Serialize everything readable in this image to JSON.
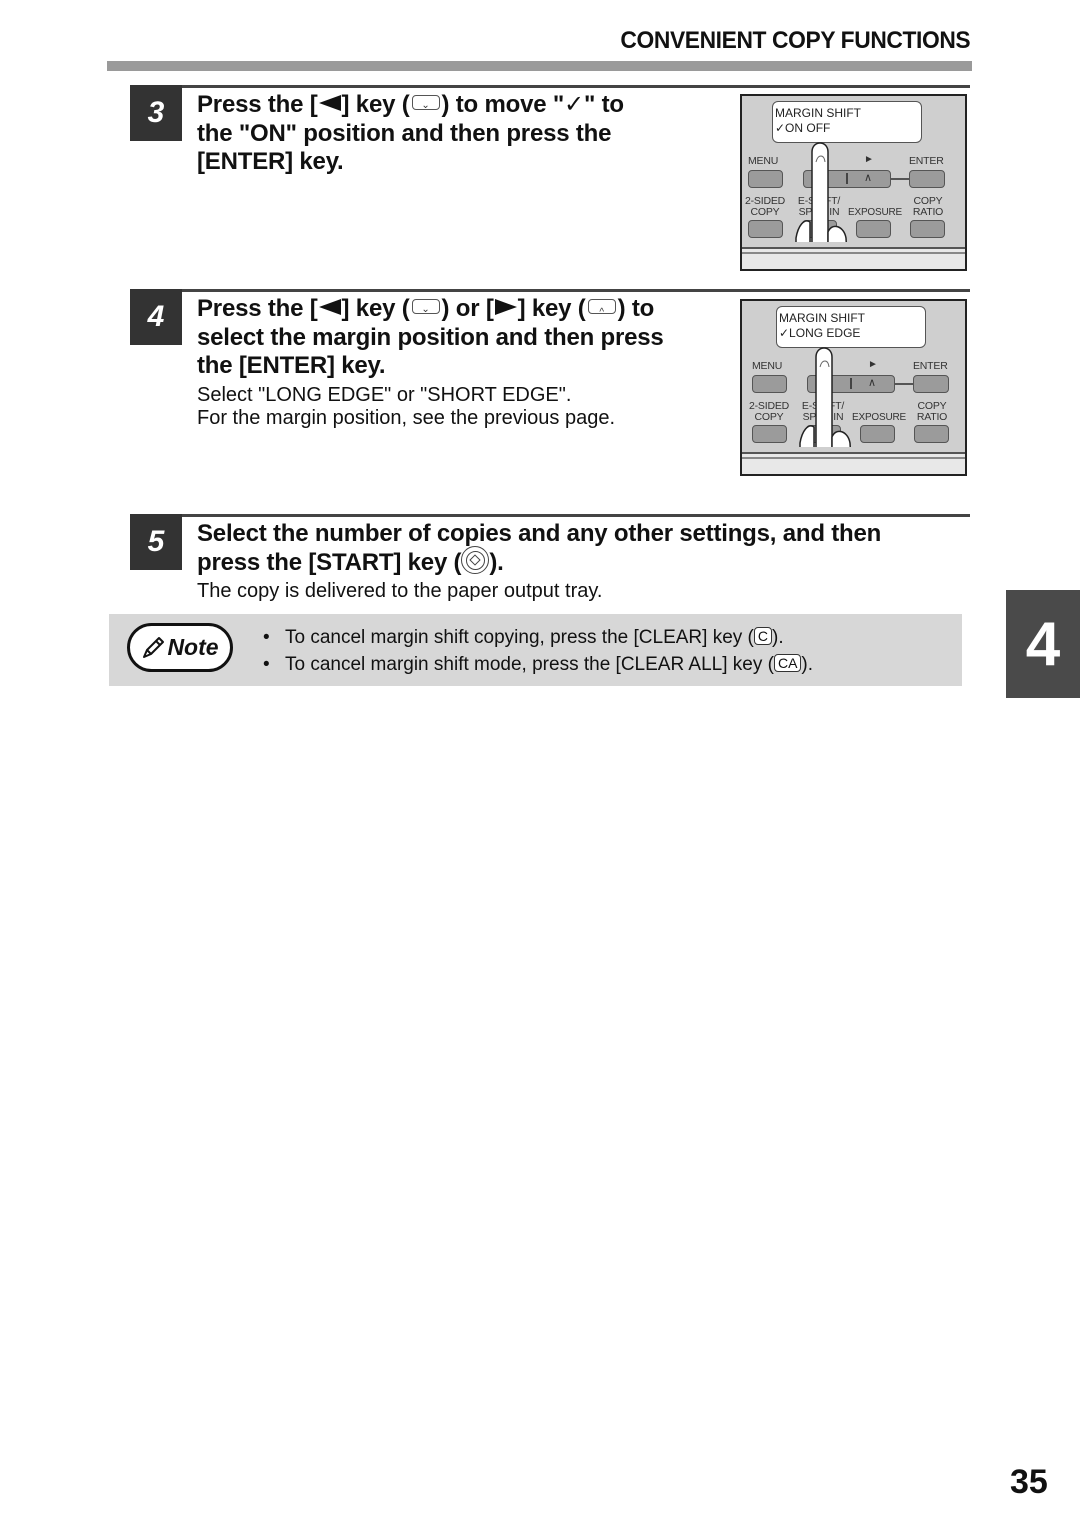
{
  "header": {
    "section_title": "CONVENIENT COPY FUNCTIONS"
  },
  "steps": [
    {
      "number": "3",
      "heading_parts": {
        "a": "Press the [",
        "b": "] key (",
        "c": ") to move \"",
        "d": "\" to",
        "line2": "the \"ON\" position and then press the",
        "line3": "[ENTER] key."
      },
      "check_glyph": "✓",
      "key_glyph_down": "⌄",
      "panel": {
        "lcd_line1": "MARGIN SHIFT",
        "lcd_line2": "✓ON    OFF",
        "labels": {
          "menu": "MENU",
          "left_arrow": "◄",
          "right_arrow": "►",
          "enter": "ENTER",
          "two_sided_1": "2-SIDED",
          "two_sided_2": "COPY",
          "eshift_1": "E-SHIFT/",
          "eshift_2": "SPLIT IN",
          "exposure": "EXPOSURE",
          "copy_ratio_1": "COPY",
          "copy_ratio_2": "RATIO",
          "down_key": "∨",
          "up_key": "∧"
        }
      }
    },
    {
      "number": "4",
      "heading_parts": {
        "a": "Press the [",
        "b": "] key (",
        "c": ") or [",
        "d": "] key (",
        "e": ") to",
        "line2": "select the margin position and then press",
        "line3": "the [ENTER] key."
      },
      "key_glyph_down": "⌄",
      "key_glyph_up": "^",
      "sub_lines": [
        "Select \"LONG EDGE\" or \"SHORT EDGE\".",
        "For the margin position, see the previous page."
      ],
      "panel": {
        "lcd_line1": "MARGIN SHIFT",
        "lcd_line2": "✓LONG EDGE",
        "labels": {
          "menu": "MENU",
          "left_arrow": "◄",
          "right_arrow": "►",
          "enter": "ENTER",
          "two_sided_1": "2-SIDED",
          "two_sided_2": "COPY",
          "eshift_1": "E-SHIFT/",
          "eshift_2": "SPLIT IN",
          "exposure": "EXPOSURE",
          "copy_ratio_1": "COPY",
          "copy_ratio_2": "RATIO",
          "down_key": "∨",
          "up_key": "∧"
        }
      }
    },
    {
      "number": "5",
      "heading_line1": "Select the number of copies and any other settings, and then",
      "heading_line2_a": "press the [START] key (",
      "heading_line2_b": ").",
      "sub_lines": [
        "The copy is delivered to the paper output tray."
      ]
    }
  ],
  "note": {
    "badge_label": "Note",
    "items": [
      {
        "before": "To cancel margin shift copying, press the [CLEAR] key (",
        "key": "C",
        "after": ")."
      },
      {
        "before": "To cancel margin shift mode, press the [CLEAR ALL] key (",
        "key": "CA",
        "after": ")."
      }
    ]
  },
  "chapter_tab": "4",
  "page_number": "35"
}
